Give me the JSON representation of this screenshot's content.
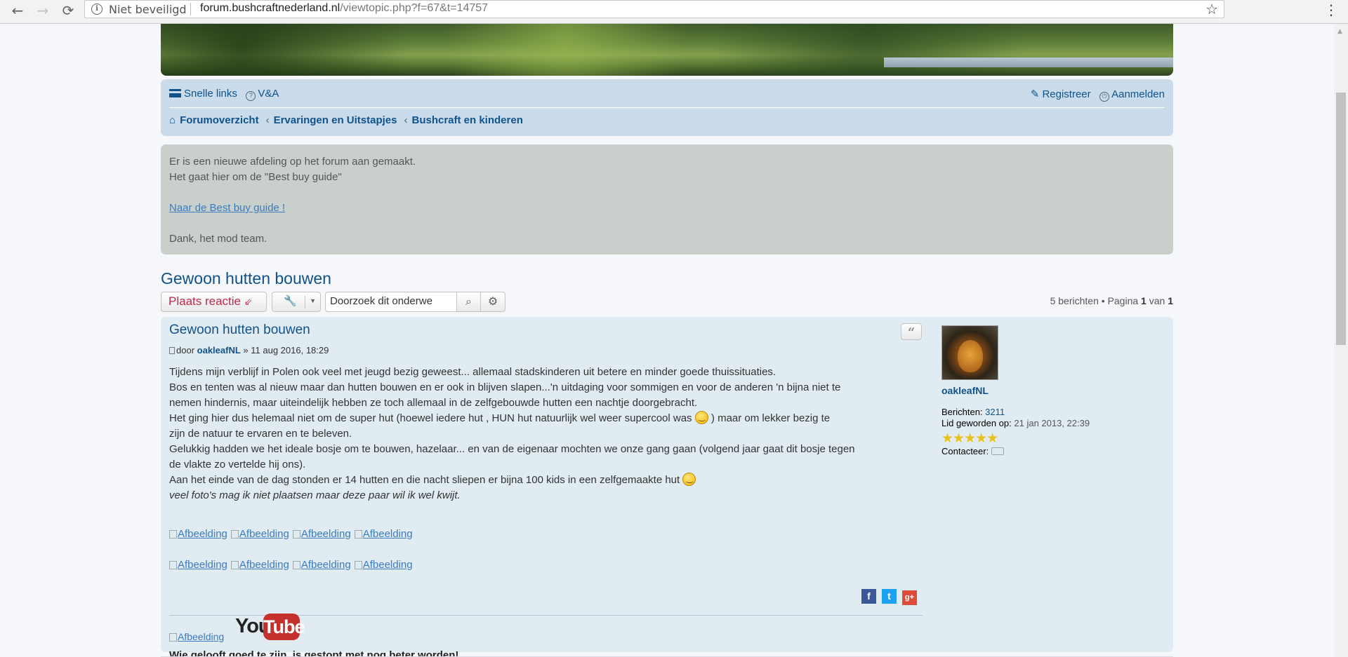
{
  "browser": {
    "security_label": "Niet beveiligd",
    "url_host": "forum.bushcraftnederland.nl",
    "url_path": "/viewtopic.php?f=67&t=14757",
    "icons": [
      "back-icon",
      "forward-icon",
      "reload-icon",
      "info-icon",
      "star-icon",
      "menu-icon"
    ]
  },
  "navbar": {
    "quick_links": "Snelle links",
    "faq": "V&A",
    "register": "Registreer",
    "login": "Aanmelden",
    "breadcrumbs": [
      "Forumoverzicht",
      "Ervaringen en Uitstapjes",
      "Bushcraft en kinderen"
    ]
  },
  "notice": {
    "line1": "Er is een nieuwe afdeling op het forum aan gemaakt.",
    "line2": "Het gaat hier om de \"Best buy guide\"",
    "link": "Naar de Best buy guide !",
    "signoff": "Dank, het mod team."
  },
  "topic": {
    "title": "Gewoon hutten bouwen"
  },
  "actions": {
    "reply_label": "Plaats reactie",
    "search_placeholder": "Doorzoek dit onderwerp…",
    "search_value": "Doorzoek dit onderwe"
  },
  "pagination": {
    "count": "5 berichten",
    "sep": "•",
    "page_label": "Pagina",
    "current": "1",
    "of_label": "van",
    "total": "1"
  },
  "post": {
    "title": "Gewoon hutten bouwen",
    "by": "door",
    "author": "oakleafNL",
    "date": "» 11 aug 2016, 18:29",
    "quote_label": "“",
    "lines": [
      "Tijdens mijn verblijf in Polen ook veel met jeugd bezig geweest... allemaal stadskinderen uit betere en minder goede thuissituaties.",
      "Bos en tenten was al nieuw maar dan hutten bouwen en er ook in blijven slapen...'n uitdaging voor sommigen en voor de anderen 'n bijna niet te",
      "nemen hindernis, maar uiteindelijk hebben ze toch allemaal in de zelfgebouwde hutten een nachtje doorgebracht.",
      "Het ging hier dus helemaal niet om de super hut (hoewel iedere hut , HUN hut natuurlijk wel weer supercool was",
      ") maar om lekker bezig te",
      "zijn de natuur te ervaren en te beleven.",
      "Gelukkig hadden we het ideale bosje om te bouwen, hazelaar... en van de eigenaar mochten we onze gang gaan (volgend jaar gaat dit bosje tegen",
      "de vlakte zo vertelde hij ons).",
      "Aan het einde van de dag stonden er 14 hutten en die nacht sliepen er bijna 100 kids in een zelfgemaakte hut",
      "veel foto's mag ik niet plaatsen maar deze paar wil ik wel kwijt."
    ],
    "image_alt": "Afbeelding",
    "image_rows": [
      [
        "Afbeelding",
        "Afbeelding",
        "Afbeelding",
        "Afbeelding"
      ],
      [
        "Afbeelding",
        "Afbeelding",
        "Afbeelding",
        "Afbeelding"
      ]
    ],
    "share": [
      "f",
      "t",
      "g+"
    ],
    "signature_image_alt": "Afbeelding",
    "youtube_you": "You",
    "youtube_tube": "Tube",
    "signature": "Wie gelooft goed te zijn, is gestopt met nog beter worden!"
  },
  "profile": {
    "name": "oakleafNL",
    "posts_label": "Berichten:",
    "posts": "3211",
    "joined_label": "Lid geworden op:",
    "joined": "21 jan 2013, 22:39",
    "stars": "★★★★★",
    "contact_label": "Contacteer:"
  },
  "colors": {
    "link": "#105289",
    "reply": "#bc2a4d",
    "navbar_bg": "#cadceb",
    "notice_bg": "#c9d0cc",
    "post_bg": "#e1ebf2"
  }
}
